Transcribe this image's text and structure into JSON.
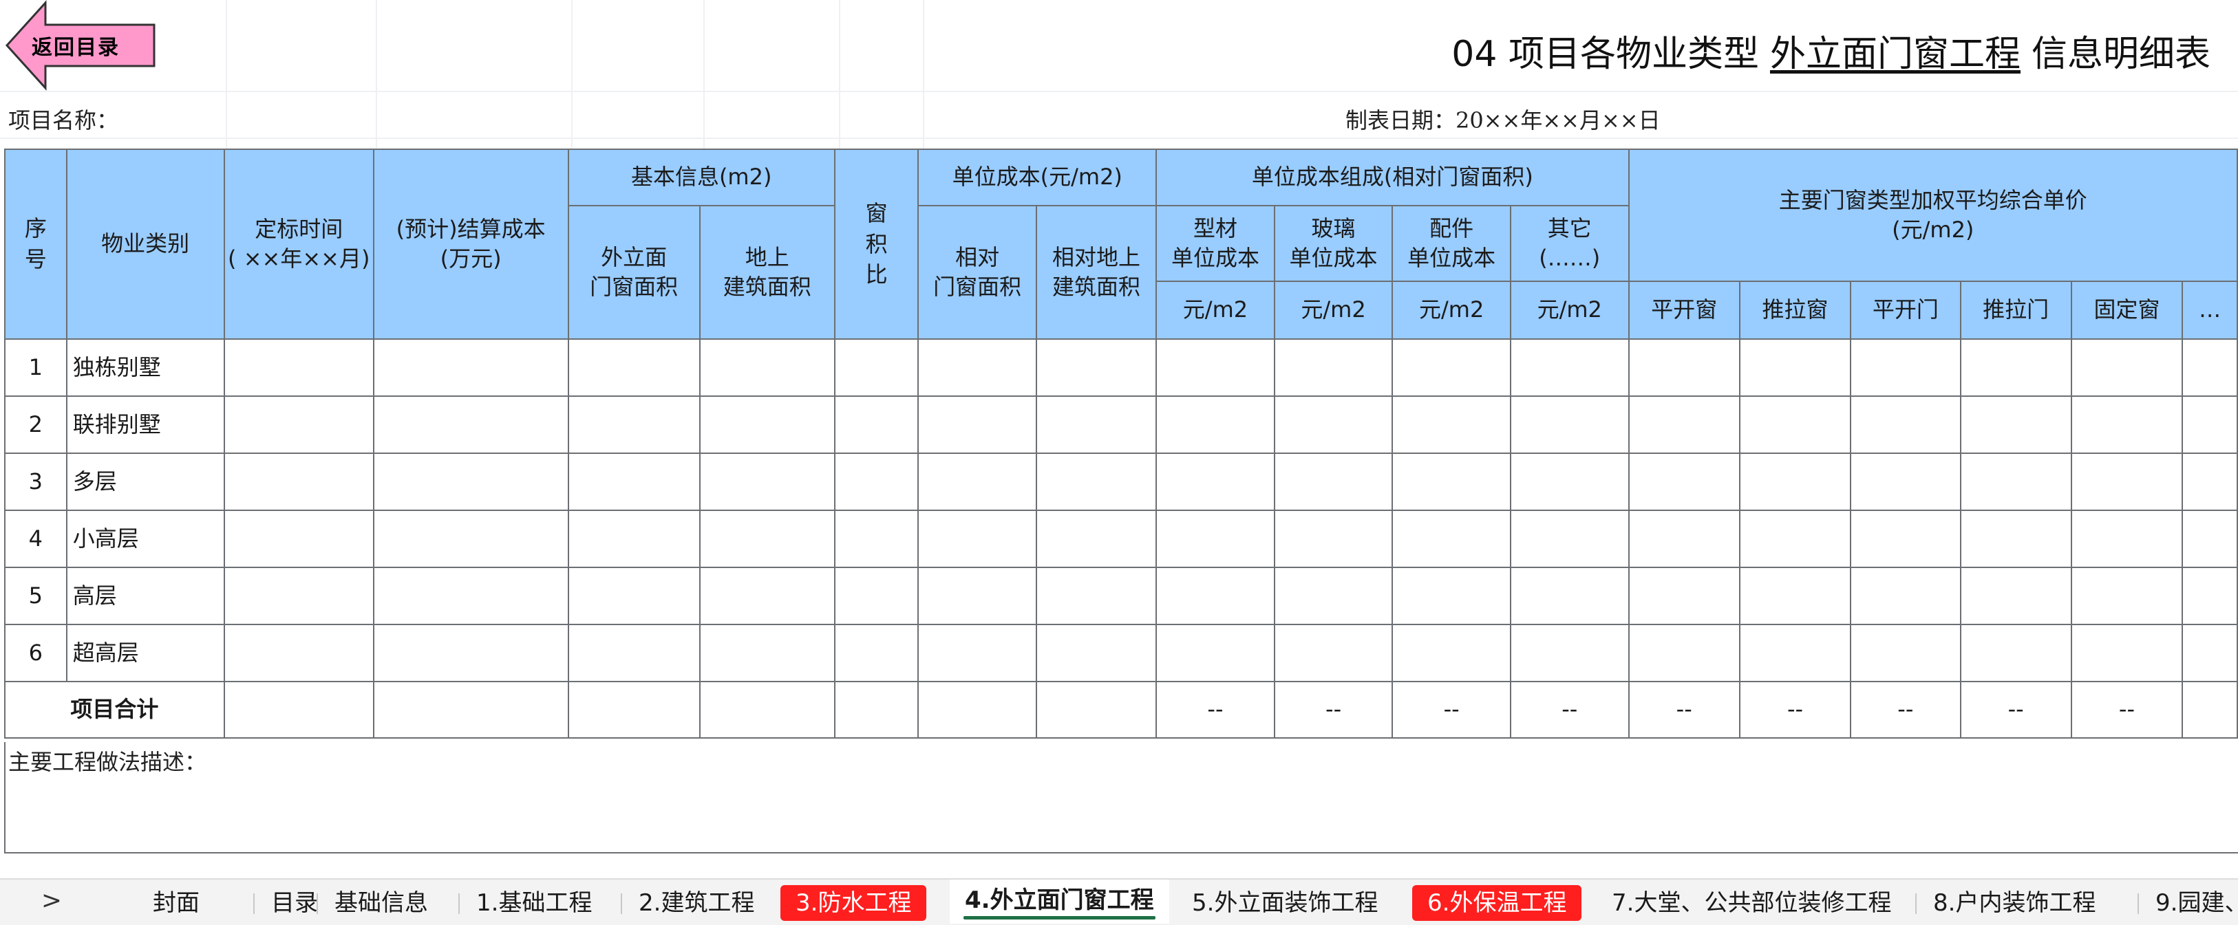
{
  "back_button": {
    "label": "返回目录"
  },
  "title": {
    "prefix": "04 项目各物业类型",
    "highlight": "外立面门窗工程",
    "suffix": "信息明细表"
  },
  "meta": {
    "project_name_label": "项目名称：",
    "date_label": "制表日期：20××年××月××日"
  },
  "table": {
    "headers": {
      "seq": "序号",
      "property_type": "物业类别",
      "bid_time": "定标时间",
      "bid_time_fmt": "( ××年××月)",
      "settle_cost": "(预计)结算成本",
      "settle_cost_unit": "(万元)",
      "basic_info": "基本信息(m2)",
      "facade_area_1": "外立面",
      "facade_area_2": "门窗面积",
      "ground_area_1": "地上",
      "ground_area_2": "建筑面积",
      "window_ratio": "窗积比",
      "unit_cost": "单位成本(元/m2)",
      "rel_window_1": "相对",
      "rel_window_2": "门窗面积",
      "rel_ground_1": "相对地上",
      "rel_ground_2": "建筑面积",
      "composition": "单位成本组成(相对门窗面积)",
      "profile_1": "型材",
      "profile_2": "单位成本",
      "glass_1": "玻璃",
      "glass_2": "单位成本",
      "fittings_1": "配件",
      "fittings_2": "单位成本",
      "other_1": "其它",
      "other_2": "(……)",
      "unit_m2": "元/m2",
      "main_types_1": "主要门窗类型加权平均综合单价",
      "main_types_2": "(元/m2)",
      "casement_window": "平开窗",
      "sliding_window": "推拉窗",
      "casement_door": "平开门",
      "sliding_door": "推拉门",
      "fixed_window": "固定窗",
      "more": "…"
    },
    "rows": [
      {
        "seq": "1",
        "name": "独栋别墅"
      },
      {
        "seq": "2",
        "name": "联排别墅"
      },
      {
        "seq": "3",
        "name": "多层"
      },
      {
        "seq": "4",
        "name": "小高层"
      },
      {
        "seq": "5",
        "name": "高层"
      },
      {
        "seq": "6",
        "name": "超高层"
      }
    ],
    "total_label": "项目合计",
    "dash": "--"
  },
  "description_label": "主要工程做法描述：",
  "sheet_tabs": {
    "nav": ">",
    "items": [
      {
        "label": "封面",
        "style": "plain"
      },
      {
        "label": "目录",
        "style": "plain"
      },
      {
        "label": "基础信息",
        "style": "plain"
      },
      {
        "label": "1.基础工程",
        "style": "plain"
      },
      {
        "label": "2.建筑工程",
        "style": "plain"
      },
      {
        "label": "3.防水工程",
        "style": "red"
      },
      {
        "label": "4.外立面门窗工程",
        "style": "active"
      },
      {
        "label": "5.外立面装饰工程",
        "style": "plain"
      },
      {
        "label": "6.外保温工程",
        "style": "red"
      },
      {
        "label": "7.大堂、公共部位装修工程",
        "style": "plain"
      },
      {
        "label": "8.户内装饰工程",
        "style": "plain"
      },
      {
        "label": "9.园建、",
        "style": "plain"
      }
    ]
  }
}
